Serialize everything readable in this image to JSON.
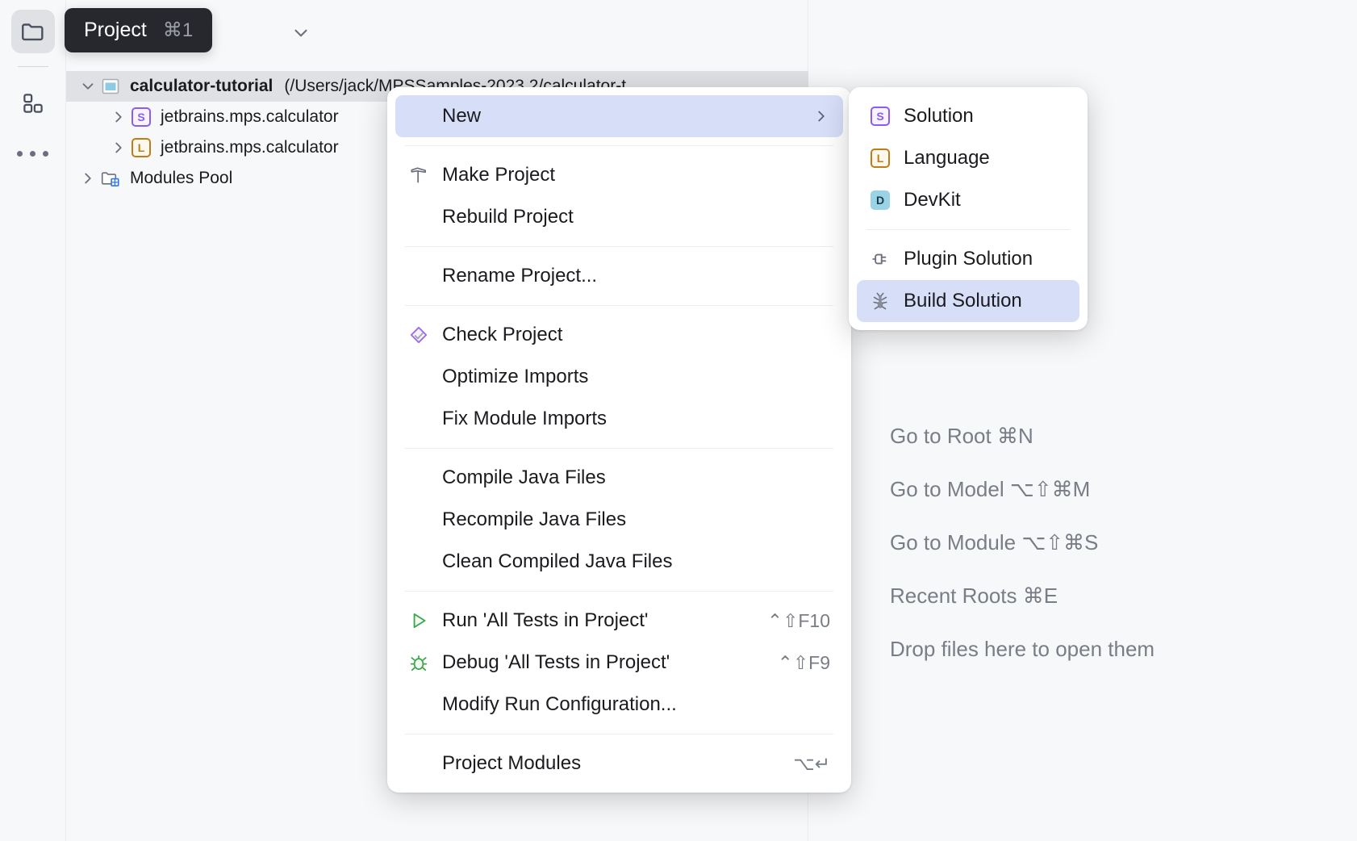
{
  "activity_bar": {
    "items": [
      {
        "name": "project-folder",
        "icon": "folder-icon",
        "active": true
      },
      {
        "name": "structure",
        "icon": "blocks-icon",
        "active": false
      },
      {
        "name": "more",
        "icon": "more-dots-icon",
        "active": false
      }
    ]
  },
  "tooltip": {
    "label": "Project",
    "shortcut": "⌘1"
  },
  "tree": {
    "rows": [
      {
        "label": "calculator-tutorial",
        "path": "(/Users/jack/MPSSamples-2023.2/calculator-t",
        "icon": "project-icon",
        "bold": true,
        "expanded": true,
        "selected": true,
        "depth": 0
      },
      {
        "label": "jetbrains.mps.calculator",
        "path": "",
        "icon": "solution-badge",
        "bold": false,
        "expanded": false,
        "selected": false,
        "depth": 1
      },
      {
        "label": "jetbrains.mps.calculator",
        "path": "",
        "icon": "language-badge",
        "bold": false,
        "expanded": false,
        "selected": false,
        "depth": 1
      },
      {
        "label": "Modules Pool",
        "path": "",
        "icon": "modules-pool-icon",
        "bold": false,
        "expanded": false,
        "selected": false,
        "depth": 0
      }
    ]
  },
  "context_menu": {
    "groups": [
      {
        "items": [
          {
            "label": "New",
            "icon": "",
            "shortcut": "",
            "submenu": true,
            "highlight": true
          }
        ]
      },
      {
        "items": [
          {
            "label": "Make Project",
            "icon": "hammer-icon",
            "shortcut": "",
            "submenu": false,
            "highlight": false
          },
          {
            "label": "Rebuild Project",
            "icon": "",
            "shortcut": "",
            "submenu": false,
            "highlight": false
          }
        ]
      },
      {
        "items": [
          {
            "label": "Rename Project...",
            "icon": "",
            "shortcut": "",
            "submenu": false,
            "highlight": false
          }
        ]
      },
      {
        "items": [
          {
            "label": "Check Project",
            "icon": "check-diamond-icon",
            "shortcut": "",
            "submenu": false,
            "highlight": false
          },
          {
            "label": "Optimize Imports",
            "icon": "",
            "shortcut": "",
            "submenu": false,
            "highlight": false
          },
          {
            "label": "Fix Module Imports",
            "icon": "",
            "shortcut": "",
            "submenu": false,
            "highlight": false
          }
        ]
      },
      {
        "items": [
          {
            "label": "Compile Java Files",
            "icon": "",
            "shortcut": "",
            "submenu": false,
            "highlight": false
          },
          {
            "label": "Recompile Java Files",
            "icon": "",
            "shortcut": "",
            "submenu": false,
            "highlight": false
          },
          {
            "label": "Clean Compiled Java Files",
            "icon": "",
            "shortcut": "",
            "submenu": false,
            "highlight": false
          }
        ]
      },
      {
        "items": [
          {
            "label": "Run 'All Tests in Project'",
            "icon": "run-icon",
            "shortcut": "⌃⇧F10",
            "submenu": false,
            "highlight": false
          },
          {
            "label": "Debug 'All Tests in Project'",
            "icon": "debug-icon",
            "shortcut": "⌃⇧F9",
            "submenu": false,
            "highlight": false
          },
          {
            "label": "Modify Run Configuration...",
            "icon": "",
            "shortcut": "",
            "submenu": false,
            "highlight": false
          }
        ]
      },
      {
        "items": [
          {
            "label": "Project Modules",
            "icon": "",
            "shortcut": "⌥↵",
            "submenu": false,
            "highlight": false
          }
        ]
      }
    ]
  },
  "submenu": {
    "groups": [
      {
        "items": [
          {
            "label": "Solution",
            "icon": "solution-badge",
            "highlight": false
          },
          {
            "label": "Language",
            "icon": "language-badge",
            "highlight": false
          },
          {
            "label": "DevKit",
            "icon": "devkit-badge",
            "highlight": false
          }
        ]
      },
      {
        "items": [
          {
            "label": "Plugin Solution",
            "icon": "plug-icon",
            "highlight": false
          },
          {
            "label": "Build Solution",
            "icon": "ant-icon",
            "highlight": true
          }
        ]
      }
    ]
  },
  "hints": {
    "lines": [
      "Go to Root ⌘N",
      "Go to Model ⌥⇧⌘M",
      "Go to Module ⌥⇧⌘S",
      "Recent Roots ⌘E",
      "Drop files here to open them"
    ]
  },
  "colors": {
    "highlight": "#D7DEF8",
    "selection": "#DFE1E5",
    "background": "#F7F8FA",
    "menu_bg": "#FFFFFF",
    "accent_purple": "#8A5CF5",
    "accent_gold": "#C07C17",
    "accent_blue": "#8CCBE2",
    "tooltip_bg": "#27282E",
    "hint_text": "#797D85"
  }
}
